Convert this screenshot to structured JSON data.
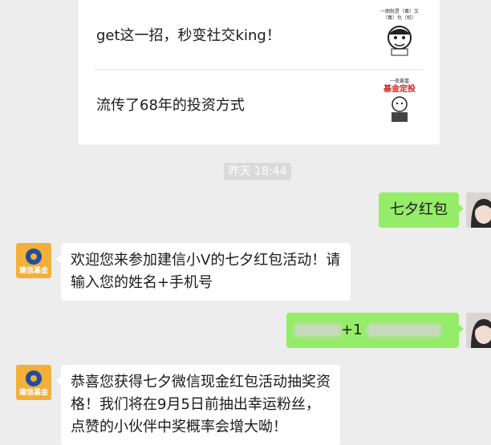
{
  "articles": [
    {
      "title": "get这一招，秒变社交king！",
      "thumb_text": "一图就是（毒）文（毒）仇（机）",
      "thumb_icon": "cartoon-face-icon"
    },
    {
      "title": "流传了68年的投资方式",
      "thumb_text": "一夜暴富",
      "thumb_highlight": "基金定投",
      "thumb_icon": "cartoon-man-icon"
    }
  ],
  "timestamp": "昨天 18:44",
  "messages": [
    {
      "side": "right",
      "text": "七夕红包"
    },
    {
      "side": "left",
      "sender": "建信基金",
      "text": "欢迎您来参加建信小V的七夕红包活动！请输入您的姓名+手机号"
    },
    {
      "side": "right",
      "text": "+1",
      "redacted": true
    },
    {
      "side": "left",
      "sender": "建信基金",
      "text": "恭喜您获得七夕微信现金红包活动抽奖资格！我们将在9月5日前抽出幸运粉丝，点赞的小伙伴中奖概率会增大呦！"
    }
  ],
  "colors": {
    "self_bubble": "#95ec69",
    "other_bubble": "#ffffff",
    "background": "#ededed"
  }
}
